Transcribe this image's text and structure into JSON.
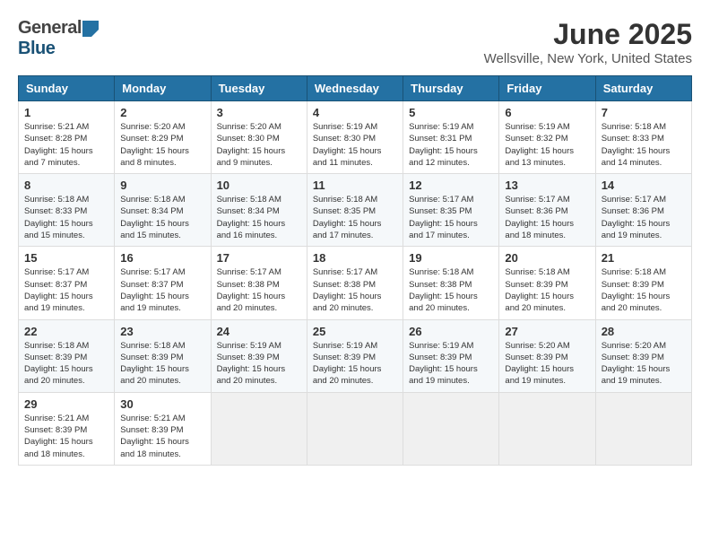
{
  "header": {
    "logo": {
      "general": "General",
      "blue": "Blue"
    },
    "title": "June 2025",
    "location": "Wellsville, New York, United States"
  },
  "calendar": {
    "days": [
      "Sunday",
      "Monday",
      "Tuesday",
      "Wednesday",
      "Thursday",
      "Friday",
      "Saturday"
    ],
    "weeks": [
      [
        {
          "day": 1,
          "sunrise": "5:21 AM",
          "sunset": "8:28 PM",
          "daylight": "15 hours and 7 minutes."
        },
        {
          "day": 2,
          "sunrise": "5:20 AM",
          "sunset": "8:29 PM",
          "daylight": "15 hours and 8 minutes."
        },
        {
          "day": 3,
          "sunrise": "5:20 AM",
          "sunset": "8:30 PM",
          "daylight": "15 hours and 9 minutes."
        },
        {
          "day": 4,
          "sunrise": "5:19 AM",
          "sunset": "8:30 PM",
          "daylight": "15 hours and 11 minutes."
        },
        {
          "day": 5,
          "sunrise": "5:19 AM",
          "sunset": "8:31 PM",
          "daylight": "15 hours and 12 minutes."
        },
        {
          "day": 6,
          "sunrise": "5:19 AM",
          "sunset": "8:32 PM",
          "daylight": "15 hours and 13 minutes."
        },
        {
          "day": 7,
          "sunrise": "5:18 AM",
          "sunset": "8:33 PM",
          "daylight": "15 hours and 14 minutes."
        }
      ],
      [
        {
          "day": 8,
          "sunrise": "5:18 AM",
          "sunset": "8:33 PM",
          "daylight": "15 hours and 15 minutes."
        },
        {
          "day": 9,
          "sunrise": "5:18 AM",
          "sunset": "8:34 PM",
          "daylight": "15 hours and 15 minutes."
        },
        {
          "day": 10,
          "sunrise": "5:18 AM",
          "sunset": "8:34 PM",
          "daylight": "15 hours and 16 minutes."
        },
        {
          "day": 11,
          "sunrise": "5:18 AM",
          "sunset": "8:35 PM",
          "daylight": "15 hours and 17 minutes."
        },
        {
          "day": 12,
          "sunrise": "5:17 AM",
          "sunset": "8:35 PM",
          "daylight": "15 hours and 17 minutes."
        },
        {
          "day": 13,
          "sunrise": "5:17 AM",
          "sunset": "8:36 PM",
          "daylight": "15 hours and 18 minutes."
        },
        {
          "day": 14,
          "sunrise": "5:17 AM",
          "sunset": "8:36 PM",
          "daylight": "15 hours and 19 minutes."
        }
      ],
      [
        {
          "day": 15,
          "sunrise": "5:17 AM",
          "sunset": "8:37 PM",
          "daylight": "15 hours and 19 minutes."
        },
        {
          "day": 16,
          "sunrise": "5:17 AM",
          "sunset": "8:37 PM",
          "daylight": "15 hours and 19 minutes."
        },
        {
          "day": 17,
          "sunrise": "5:17 AM",
          "sunset": "8:38 PM",
          "daylight": "15 hours and 20 minutes."
        },
        {
          "day": 18,
          "sunrise": "5:17 AM",
          "sunset": "8:38 PM",
          "daylight": "15 hours and 20 minutes."
        },
        {
          "day": 19,
          "sunrise": "5:18 AM",
          "sunset": "8:38 PM",
          "daylight": "15 hours and 20 minutes."
        },
        {
          "day": 20,
          "sunrise": "5:18 AM",
          "sunset": "8:39 PM",
          "daylight": "15 hours and 20 minutes."
        },
        {
          "day": 21,
          "sunrise": "5:18 AM",
          "sunset": "8:39 PM",
          "daylight": "15 hours and 20 minutes."
        }
      ],
      [
        {
          "day": 22,
          "sunrise": "5:18 AM",
          "sunset": "8:39 PM",
          "daylight": "15 hours and 20 minutes."
        },
        {
          "day": 23,
          "sunrise": "5:18 AM",
          "sunset": "8:39 PM",
          "daylight": "15 hours and 20 minutes."
        },
        {
          "day": 24,
          "sunrise": "5:19 AM",
          "sunset": "8:39 PM",
          "daylight": "15 hours and 20 minutes."
        },
        {
          "day": 25,
          "sunrise": "5:19 AM",
          "sunset": "8:39 PM",
          "daylight": "15 hours and 20 minutes."
        },
        {
          "day": 26,
          "sunrise": "5:19 AM",
          "sunset": "8:39 PM",
          "daylight": "15 hours and 19 minutes."
        },
        {
          "day": 27,
          "sunrise": "5:20 AM",
          "sunset": "8:39 PM",
          "daylight": "15 hours and 19 minutes."
        },
        {
          "day": 28,
          "sunrise": "5:20 AM",
          "sunset": "8:39 PM",
          "daylight": "15 hours and 19 minutes."
        }
      ],
      [
        {
          "day": 29,
          "sunrise": "5:21 AM",
          "sunset": "8:39 PM",
          "daylight": "15 hours and 18 minutes."
        },
        {
          "day": 30,
          "sunrise": "5:21 AM",
          "sunset": "8:39 PM",
          "daylight": "15 hours and 18 minutes."
        },
        null,
        null,
        null,
        null,
        null
      ]
    ]
  }
}
